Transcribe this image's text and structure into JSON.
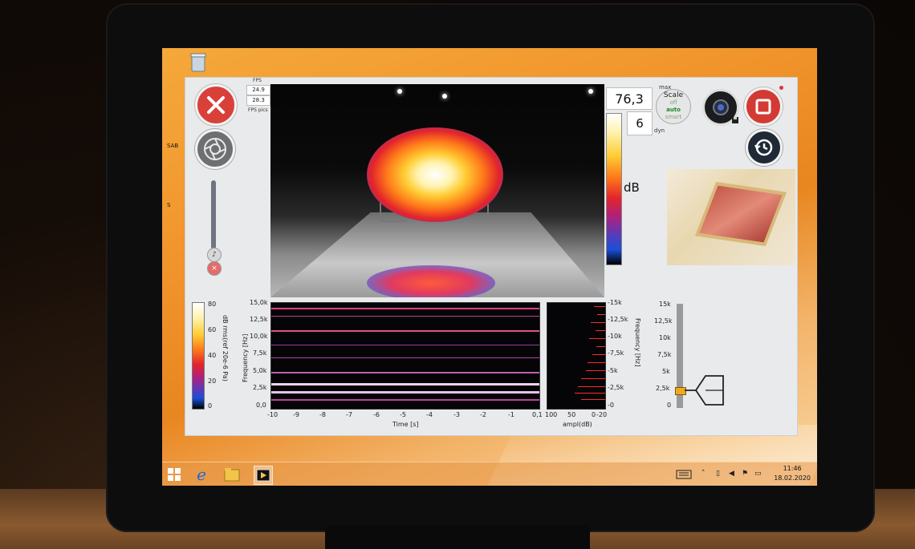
{
  "desktop": {
    "icon_labels": [
      "SAB",
      "S"
    ]
  },
  "app": {
    "fps": {
      "label_top": "FPS",
      "value1": "24.9",
      "value2": "28.3",
      "label_bottom": "FPS pics"
    },
    "level": {
      "max_label": "max",
      "max_value": "76,3",
      "dyn_value": "6",
      "dyn_label": "dyn",
      "unit": "dB"
    },
    "scale_button": {
      "title": "Scale",
      "options": [
        "off",
        "auto",
        "smart"
      ],
      "selected": "auto"
    },
    "spectrogram_ampl_scale": {
      "ticks": [
        "80",
        "60",
        "40",
        "20",
        "0"
      ],
      "label": "dB rms(ref 20e-6 Pa)"
    },
    "spectrogram": {
      "y_ticks": [
        "15,0k",
        "12,5k",
        "10,0k",
        "7,5k",
        "5,0k",
        "2,5k",
        "0,0"
      ],
      "y_label": "Frequency [Hz]",
      "x_ticks": [
        "-10",
        "-9",
        "-8",
        "-7",
        "-6",
        "-5",
        "-4",
        "-3",
        "-2",
        "-1",
        "0,1"
      ],
      "x_label": "Time [s]"
    },
    "spectrum": {
      "x_ticks": [
        "100",
        "50",
        "0",
        "-20"
      ],
      "x_label": "ampl(dB)",
      "y_ticks": [
        "-15k",
        "-12,5k",
        "-10k",
        "-7,5k",
        "-5k",
        "-2,5k",
        "-0"
      ],
      "y_label": "Frequency [Hz]"
    },
    "filter_slider": {
      "ticks": [
        "15k",
        "12,5k",
        "10k",
        "7,5k",
        "5k",
        "2,5k",
        "0"
      ]
    },
    "colors": {
      "exit": "#d9403a",
      "record": "#d43a34",
      "spectrum_bars": "#ff2b2b",
      "slider_thumb": "#f2a81e"
    }
  },
  "taskbar": {
    "time": "11:46",
    "date": "18.02.2020"
  }
}
